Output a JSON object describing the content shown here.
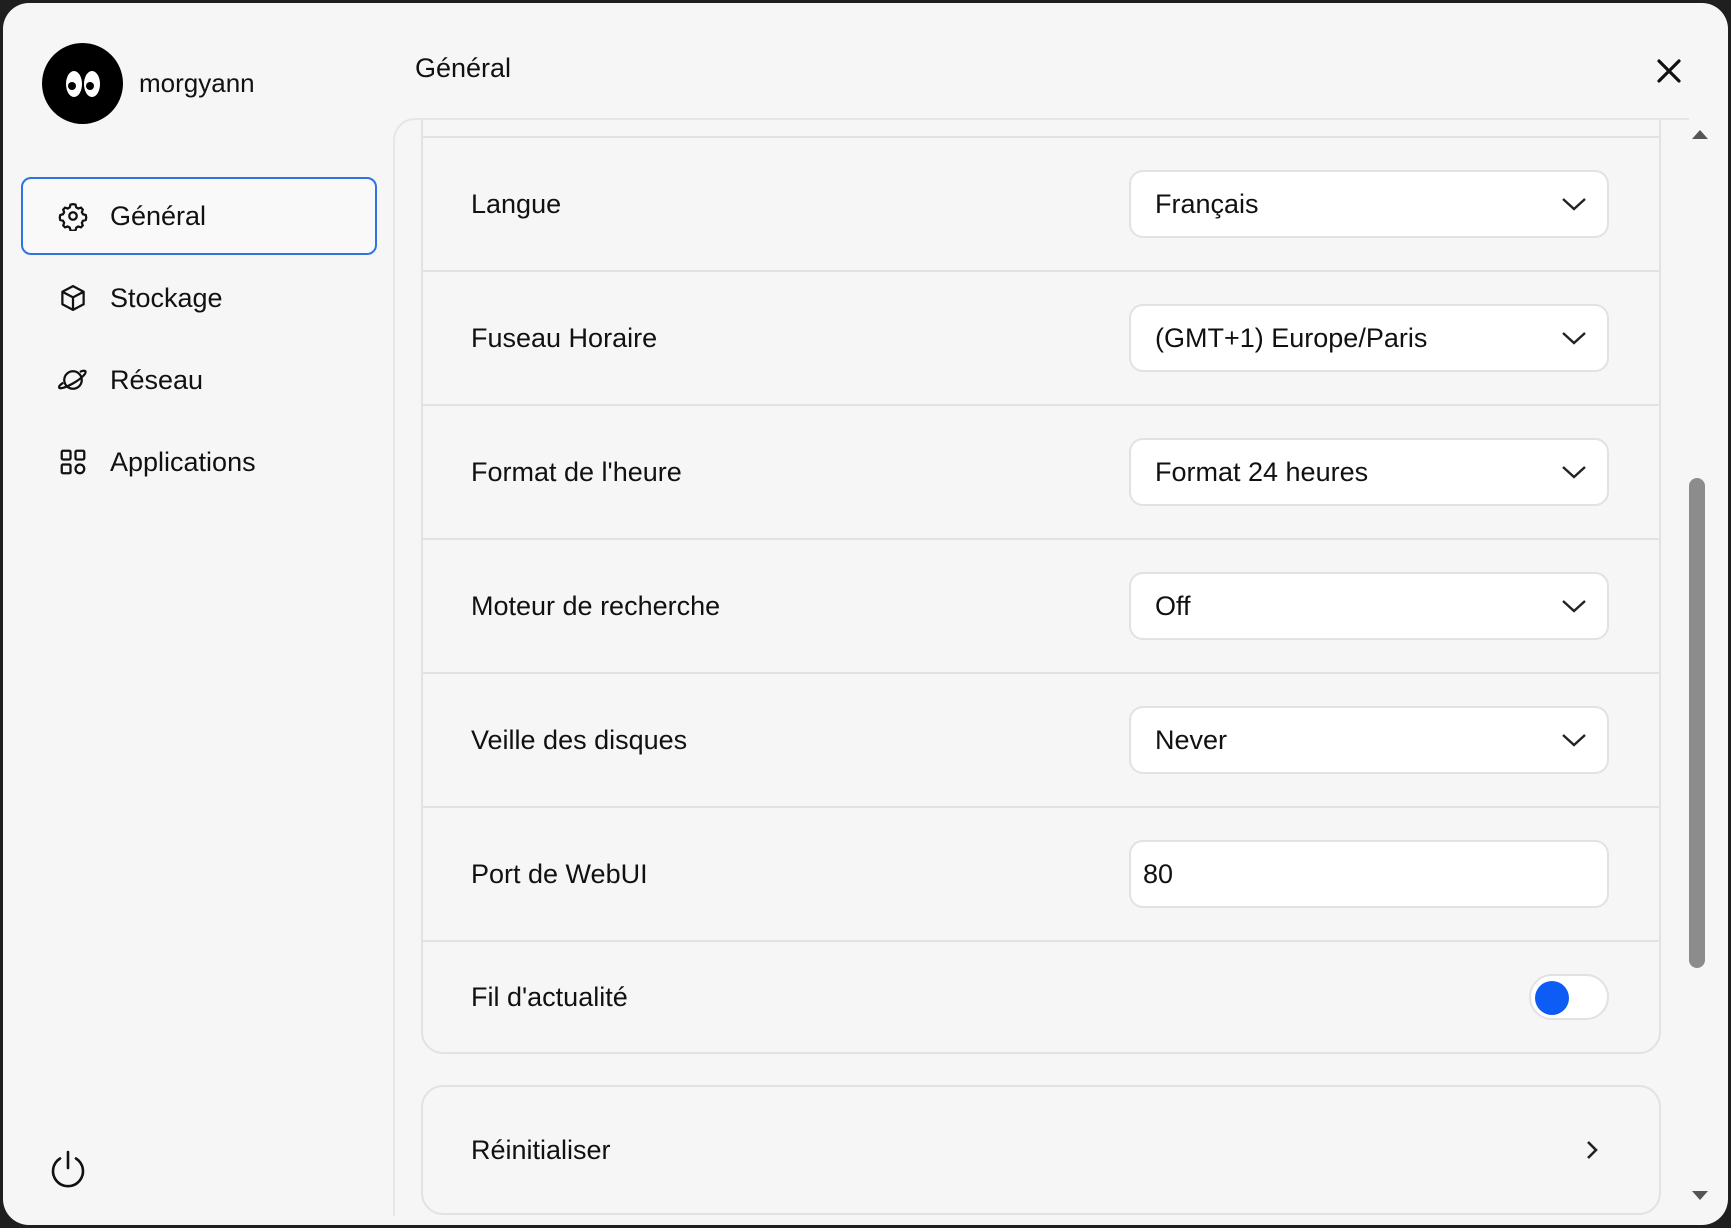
{
  "user": {
    "name": "morgyann"
  },
  "header": {
    "title": "Général"
  },
  "sidebar": {
    "items": [
      {
        "label": "Général",
        "icon": "gear-icon"
      },
      {
        "label": "Stockage",
        "icon": "box-icon"
      },
      {
        "label": "Réseau",
        "icon": "planet-icon"
      },
      {
        "label": "Applications",
        "icon": "grid-icon"
      }
    ]
  },
  "settings": {
    "language": {
      "label": "Langue",
      "value": "Français"
    },
    "timezone": {
      "label": "Fuseau Horaire",
      "value": "(GMT+1) Europe/Paris"
    },
    "time_format": {
      "label": "Format de l'heure",
      "value": "Format 24 heures"
    },
    "search_engine": {
      "label": "Moteur de recherche",
      "value": "Off"
    },
    "disk_sleep": {
      "label": "Veille des disques",
      "value": "Never"
    },
    "webui_port": {
      "label": "Port de WebUI",
      "value": "80"
    },
    "news_feed": {
      "label": "Fil d'actualité",
      "enabled": true
    }
  },
  "reset": {
    "label": "Réinitialiser"
  },
  "colors": {
    "accent": "#2f73e3",
    "toggle_on": "#0c5cf5"
  }
}
